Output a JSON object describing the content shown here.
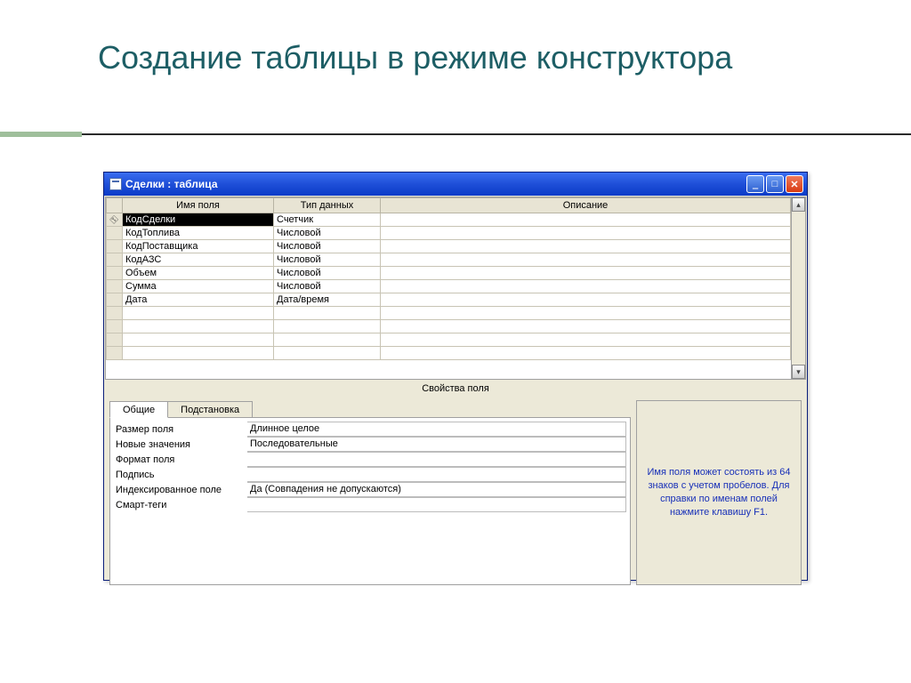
{
  "slide": {
    "title": "Создание таблицы в режиме конструктора"
  },
  "window": {
    "title": "Сделки : таблица",
    "columns": {
      "name": "Имя поля",
      "type": "Тип данных",
      "desc": "Описание"
    },
    "fields": [
      {
        "key": true,
        "name": "КодСделки",
        "type": "Счетчик",
        "desc": ""
      },
      {
        "key": false,
        "name": "КодТоплива",
        "type": "Числовой",
        "desc": ""
      },
      {
        "key": false,
        "name": "КодПоставщика",
        "type": "Числовой",
        "desc": ""
      },
      {
        "key": false,
        "name": "КодАЗС",
        "type": "Числовой",
        "desc": ""
      },
      {
        "key": false,
        "name": "Объем",
        "type": "Числовой",
        "desc": ""
      },
      {
        "key": false,
        "name": "Сумма",
        "type": "Числовой",
        "desc": ""
      },
      {
        "key": false,
        "name": "Дата",
        "type": "Дата/время",
        "desc": ""
      }
    ],
    "props_label": "Свойства поля",
    "tabs": {
      "general": "Общие",
      "lookup": "Подстановка"
    },
    "props": [
      {
        "label": "Размер поля",
        "value": "Длинное целое"
      },
      {
        "label": "Новые значения",
        "value": "Последовательные"
      },
      {
        "label": "Формат поля",
        "value": ""
      },
      {
        "label": "Подпись",
        "value": ""
      },
      {
        "label": "Индексированное поле",
        "value": "Да (Совпадения не допускаются)"
      },
      {
        "label": "Смарт-теги",
        "value": ""
      }
    ],
    "help": "Имя поля может состоять из 64 знаков с учетом пробелов.  Для справки по именам полей нажмите клавишу F1."
  }
}
